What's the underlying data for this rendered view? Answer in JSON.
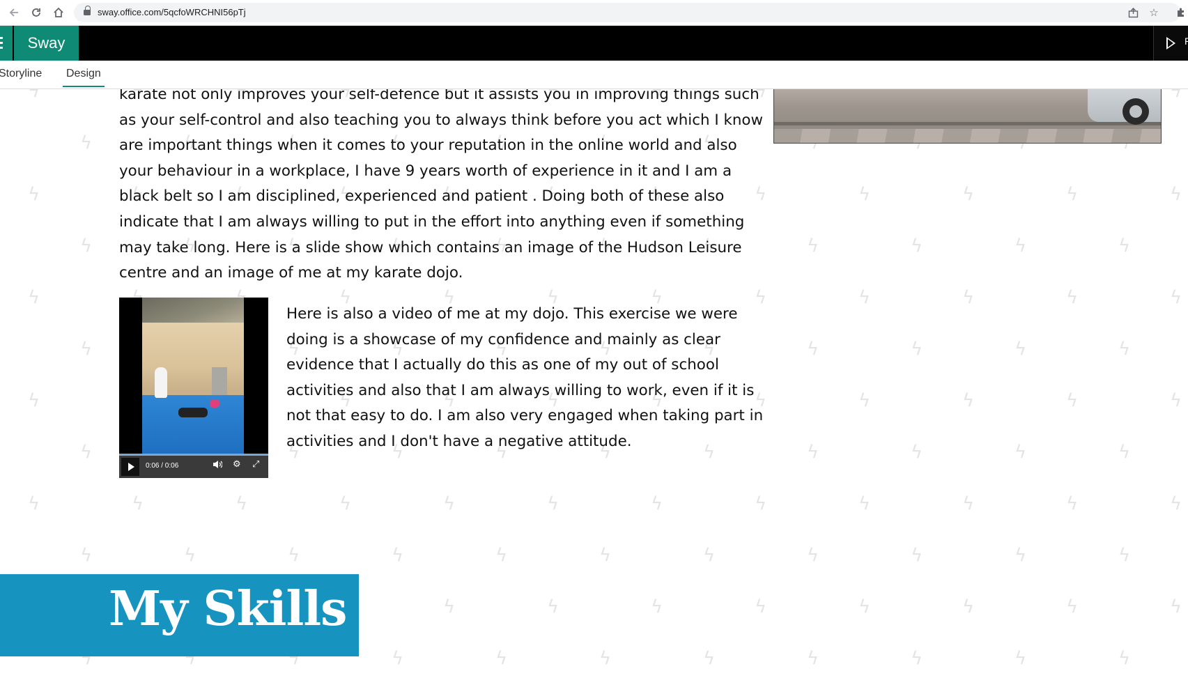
{
  "browser": {
    "url": "sway.office.com/5qcfoWRCHNI56pTj",
    "icons": [
      "back-arrow-icon",
      "reload-icon",
      "home-icon",
      "lock-icon",
      "share-icon",
      "star-icon",
      "extensions-icon"
    ]
  },
  "app": {
    "name": "Sway",
    "play_label": "P",
    "accent_color": "#0f8a74"
  },
  "tabs": [
    {
      "label": "Storyline",
      "active": false
    },
    {
      "label": "Design",
      "active": true
    }
  ],
  "content": {
    "paragraph_1": "karate not only improves your self-defence but it assists you in improving things such as your self-control and also teaching you to always think before you act which I know are important things when it comes to your reputation in the online world and also your behaviour in a workplace, I have 9 years worth of experience in it and I am a black belt so I am disciplined, experienced and patient . Doing both of these also indicate that I am always willing to put in the effort into anything even if something may take long. Here is a slide show which contains an image of the Hudson Leisure centre and an image of me at my karate dojo.",
    "paragraph_2": "Here is also a video of me at my dojo. This exercise we were doing is a showcase of my confidence and mainly as clear evidence that I actually do this as one of my out of school activities and also that I am always willing to work, even if it is not that easy to do. I am also very engaged when taking part in activities and I don't have a negative attitude.",
    "video": {
      "time": "0:06 / 0:06",
      "progress_fraction": 1.0
    }
  },
  "section": {
    "title": "My Skills",
    "banner_color": "#1793bf"
  }
}
